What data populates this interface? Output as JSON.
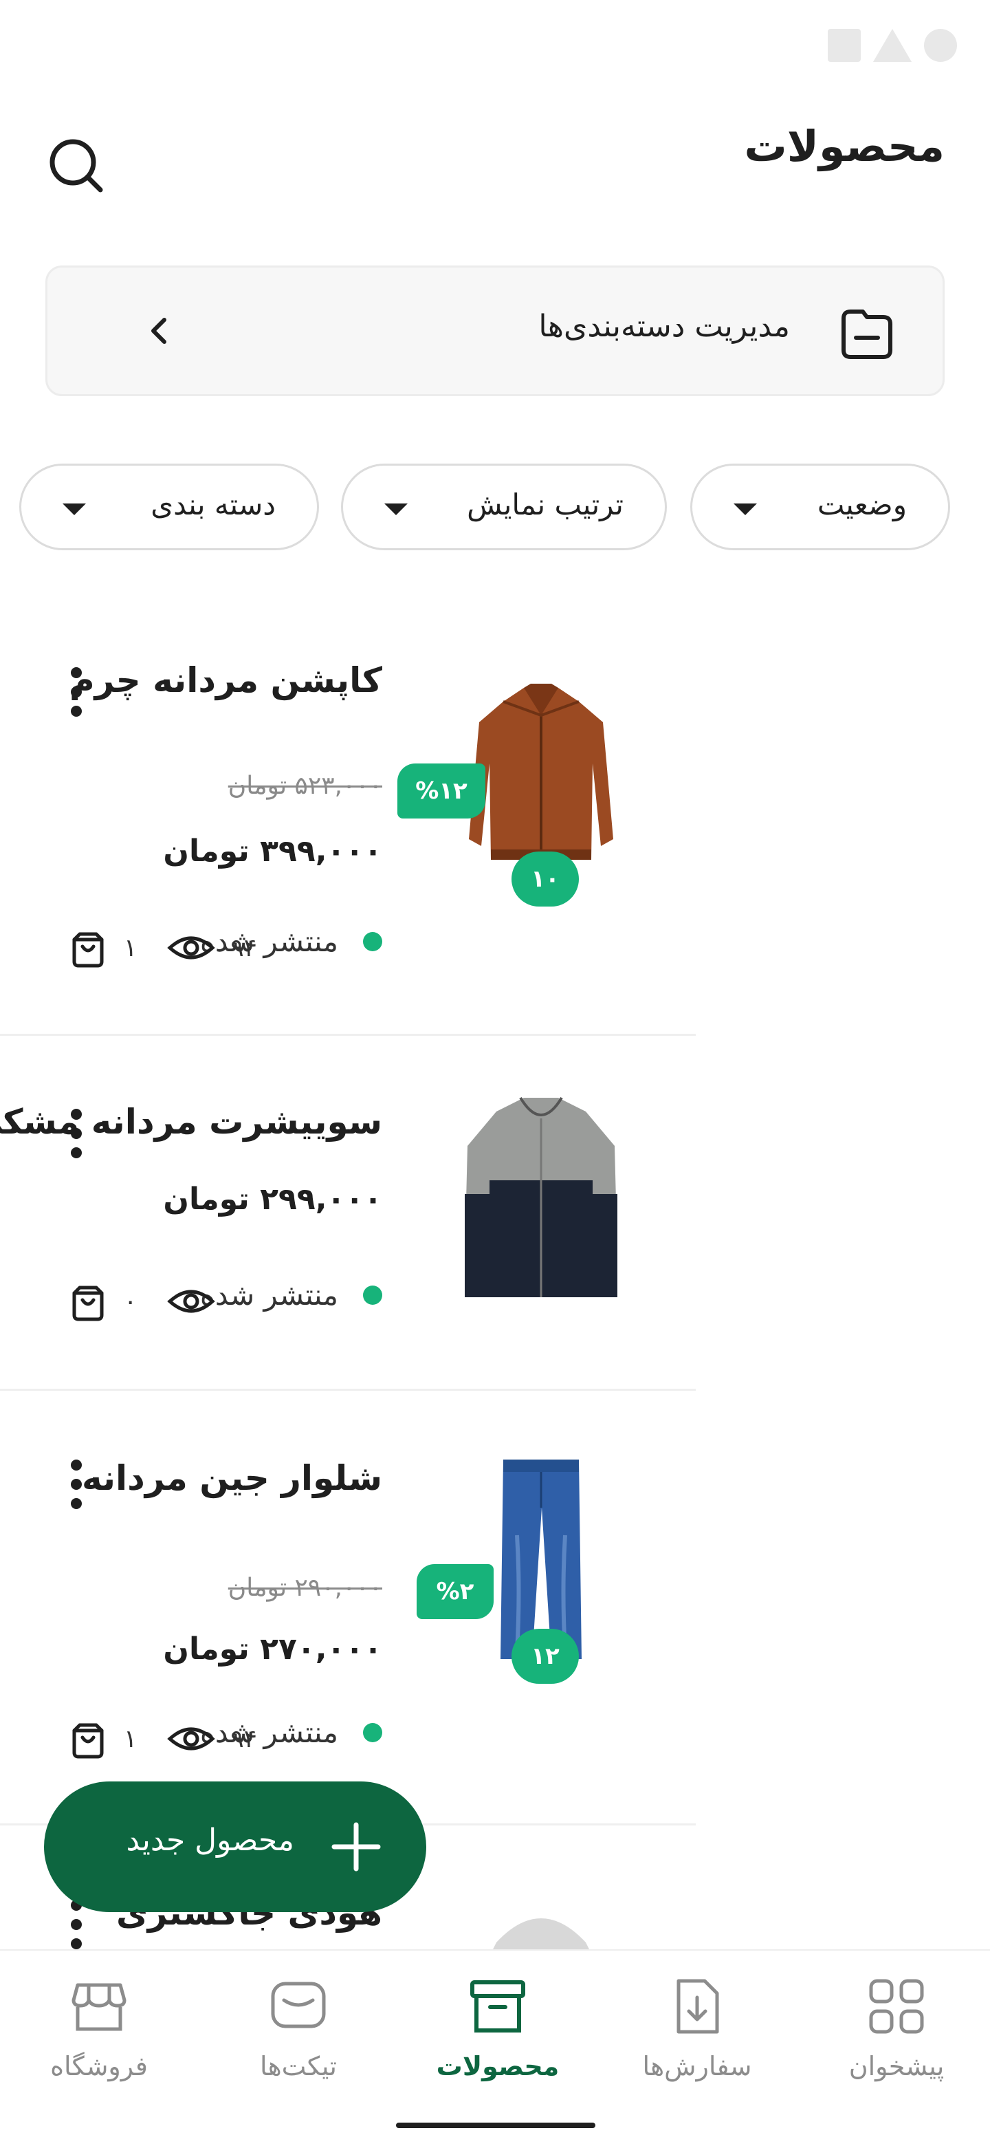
{
  "header": {
    "title": "محصولات"
  },
  "category_manager": {
    "label": "مدیریت دسته‌بندی‌ها"
  },
  "filters": [
    {
      "label": "وضعیت"
    },
    {
      "label": "ترتیب نمایش"
    },
    {
      "label": "دسته بندی"
    }
  ],
  "products": [
    {
      "title": "کاپشن مردانه چرم",
      "old_price": "۵۲۳,۰۰۰ تومان",
      "discount": "%۱۲",
      "price": "۳۹۹,۰۰۰ تومان",
      "status": "منتشر شده",
      "views": "۹۴",
      "orders": "۱",
      "stock_badge": "۱۰"
    },
    {
      "title": "سوییشرت مردانه مشکی",
      "price": "۲۹۹,۰۰۰ تومان",
      "status": "منتشر شده",
      "views": "۰",
      "orders": "۰"
    },
    {
      "title": "شلوار جین مردانه",
      "old_price": "۲۹۰,۰۰۰ تومان",
      "discount": "%۲",
      "price": "۲۷۰,۰۰۰ تومان",
      "status": "منتشر شده",
      "views": "۹۴",
      "orders": "۱",
      "stock_badge": "۱۲"
    },
    {
      "title": "هودی جاکستری"
    }
  ],
  "fab": {
    "label": "محصول جدید"
  },
  "bottom_nav": [
    {
      "label": "فروشگاه",
      "icon": "store-icon",
      "active": false
    },
    {
      "label": "تیکت‌ها",
      "icon": "chat-icon",
      "active": false
    },
    {
      "label": "محصولات",
      "icon": "archive-box-icon",
      "active": true
    },
    {
      "label": "سفارش‌ها",
      "icon": "download-doc-icon",
      "active": false
    },
    {
      "label": "پیشخوان",
      "icon": "grid-icon",
      "active": false
    }
  ],
  "colors": {
    "accent": "#17b37a",
    "brand_dark": "#0d6640",
    "muted_text": "#8c8c8c"
  }
}
